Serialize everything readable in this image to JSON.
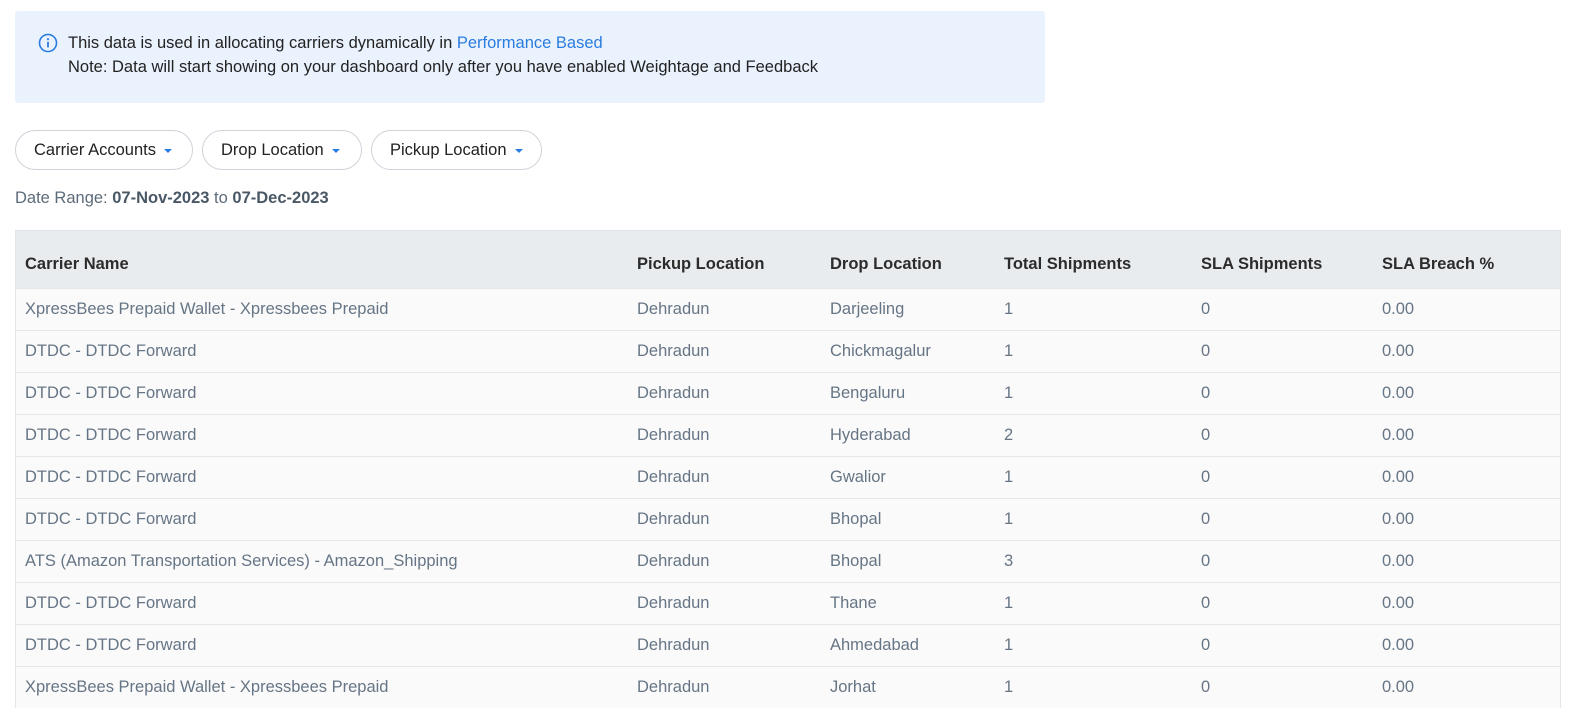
{
  "info": {
    "line1_prefix": "This data is used in allocating carriers dynamically in ",
    "line1_link": "Performance Based",
    "line2": "Note: Data will start showing on your dashboard only after you have enabled Weightage and Feedback",
    "icon": "info-circle-icon",
    "accent_color": "#2b7ce0"
  },
  "filters": [
    {
      "label": "Carrier Accounts"
    },
    {
      "label": "Drop Location"
    },
    {
      "label": "Pickup Location"
    }
  ],
  "date_range": {
    "label": "Date Range: ",
    "from": "07-Nov-2023",
    "separator": " to ",
    "to": "07-Dec-2023"
  },
  "table": {
    "columns": [
      "Carrier Name",
      "Pickup Location",
      "Drop Location",
      "Total Shipments",
      "SLA Shipments",
      "SLA Breach %"
    ],
    "rows": [
      [
        "XpressBees Prepaid Wallet - Xpressbees Prepaid",
        "Dehradun",
        "Darjeeling",
        "1",
        "0",
        "0.00"
      ],
      [
        "DTDC - DTDC Forward",
        "Dehradun",
        "Chickmagalur",
        "1",
        "0",
        "0.00"
      ],
      [
        "DTDC - DTDC Forward",
        "Dehradun",
        "Bengaluru",
        "1",
        "0",
        "0.00"
      ],
      [
        "DTDC - DTDC Forward",
        "Dehradun",
        "Hyderabad",
        "2",
        "0",
        "0.00"
      ],
      [
        "DTDC - DTDC Forward",
        "Dehradun",
        "Gwalior",
        "1",
        "0",
        "0.00"
      ],
      [
        "DTDC - DTDC Forward",
        "Dehradun",
        "Bhopal",
        "1",
        "0",
        "0.00"
      ],
      [
        "ATS (Amazon Transportation Services) - Amazon_Shipping",
        "Dehradun",
        "Bhopal",
        "3",
        "0",
        "0.00"
      ],
      [
        "DTDC - DTDC Forward",
        "Dehradun",
        "Thane",
        "1",
        "0",
        "0.00"
      ],
      [
        "DTDC - DTDC Forward",
        "Dehradun",
        "Ahmedabad",
        "1",
        "0",
        "0.00"
      ],
      [
        "XpressBees Prepaid Wallet - Xpressbees Prepaid",
        "Dehradun",
        "Jorhat",
        "1",
        "0",
        "0.00"
      ]
    ]
  }
}
